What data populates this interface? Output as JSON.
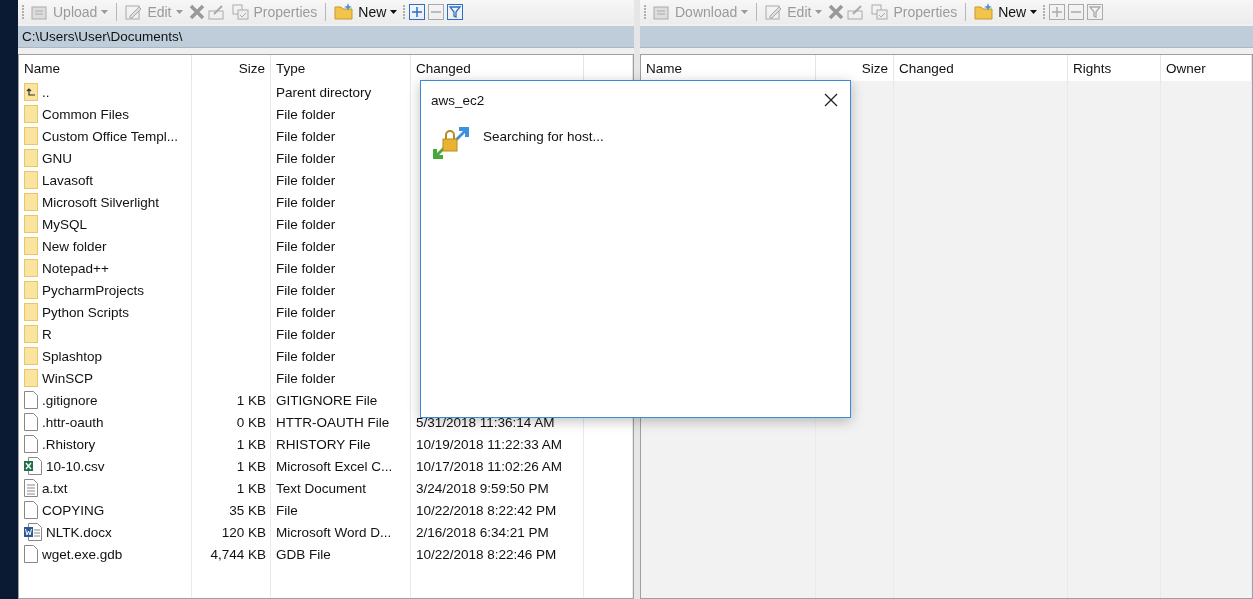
{
  "panels": [
    {
      "toolbar": [
        {
          "kind": "grip"
        },
        {
          "kind": "upload",
          "label": "Upload",
          "disabled": true,
          "dropdown": true
        },
        {
          "kind": "separator"
        },
        {
          "kind": "edit",
          "label": "Edit",
          "disabled": true,
          "dropdown": true
        },
        {
          "kind": "delete",
          "disabled": true
        },
        {
          "kind": "rename",
          "disabled": true
        },
        {
          "kind": "properties",
          "label": "Properties",
          "disabled": true
        },
        {
          "kind": "separator"
        },
        {
          "kind": "new",
          "label": "New",
          "disabled": false,
          "dropdown": true
        },
        {
          "kind": "grip"
        },
        {
          "kind": "select",
          "disabled": false
        },
        {
          "kind": "unselect",
          "disabled": true
        },
        {
          "kind": "filter",
          "disabled": false
        }
      ],
      "path": "C:\\Users\\User\\Documents\\",
      "columns": [
        "Name",
        "Size",
        "Type",
        "Changed"
      ],
      "rows": [
        {
          "kind": "parent",
          "name": "..",
          "type": "Parent directory"
        },
        {
          "kind": "folder",
          "name": "Common Files",
          "type": "File folder"
        },
        {
          "kind": "folder",
          "name": "Custom Office Templ...",
          "type": "File folder"
        },
        {
          "kind": "folder",
          "name": "GNU",
          "type": "File folder"
        },
        {
          "kind": "folder",
          "name": "Lavasoft",
          "type": "File folder"
        },
        {
          "kind": "folder",
          "name": "Microsoft Silverlight",
          "type": "File folder"
        },
        {
          "kind": "folder",
          "name": "MySQL",
          "type": "File folder"
        },
        {
          "kind": "folder",
          "name": "New folder",
          "type": "File folder"
        },
        {
          "kind": "folder",
          "name": "Notepad++",
          "type": "File folder"
        },
        {
          "kind": "folder",
          "name": "PycharmProjects",
          "type": "File folder"
        },
        {
          "kind": "folder",
          "name": "Python Scripts",
          "type": "File folder"
        },
        {
          "kind": "folder",
          "name": "R",
          "type": "File folder"
        },
        {
          "kind": "folder",
          "name": "Splashtop",
          "type": "File folder"
        },
        {
          "kind": "folder",
          "name": "WinSCP",
          "type": "File folder"
        },
        {
          "kind": "file",
          "name": ".gitignore",
          "size": "1 KB",
          "type": "GITIGNORE File"
        },
        {
          "kind": "file",
          "name": ".httr-oauth",
          "size": "0 KB",
          "type": "HTTR-OAUTH File",
          "changed": "5/31/2018  11:36:14 AM"
        },
        {
          "kind": "file",
          "name": ".Rhistory",
          "size": "1 KB",
          "type": "RHISTORY File",
          "changed": "10/19/2018  11:22:33 AM"
        },
        {
          "kind": "excel",
          "name": "10-10.csv",
          "size": "1 KB",
          "type": "Microsoft Excel C...",
          "changed": "10/17/2018  11:02:26 AM"
        },
        {
          "kind": "text",
          "name": "a.txt",
          "size": "1 KB",
          "type": "Text Document",
          "changed": "3/24/2018  9:59:50 PM"
        },
        {
          "kind": "file",
          "name": "COPYING",
          "size": "35 KB",
          "type": "File",
          "changed": "10/22/2018  8:22:42 PM"
        },
        {
          "kind": "word",
          "name": "NLTK.docx",
          "size": "120 KB",
          "type": "Microsoft Word D...",
          "changed": "2/16/2018  6:34:21 PM"
        },
        {
          "kind": "file",
          "name": "wget.exe.gdb",
          "size": "4,744 KB",
          "type": "GDB File",
          "changed": "10/22/2018  8:22:46 PM"
        }
      ]
    },
    {
      "toolbar": [
        {
          "kind": "grip"
        },
        {
          "kind": "download",
          "label": "Download",
          "disabled": true,
          "dropdown": true
        },
        {
          "kind": "separator"
        },
        {
          "kind": "edit",
          "label": "Edit",
          "disabled": true,
          "dropdown": true
        },
        {
          "kind": "delete",
          "disabled": true
        },
        {
          "kind": "rename",
          "disabled": true
        },
        {
          "kind": "properties",
          "label": "Properties",
          "disabled": true
        },
        {
          "kind": "separator"
        },
        {
          "kind": "new",
          "label": "New",
          "disabled": false,
          "dropdown": true
        },
        {
          "kind": "grip"
        },
        {
          "kind": "select",
          "disabled": true
        },
        {
          "kind": "unselect",
          "disabled": true
        },
        {
          "kind": "filter",
          "disabled": true
        }
      ],
      "columns": [
        "Name",
        "Size",
        "Changed",
        "Rights",
        "Owner"
      ]
    }
  ],
  "dialog": {
    "title": "aws_ec2",
    "message": "Searching for host..."
  }
}
